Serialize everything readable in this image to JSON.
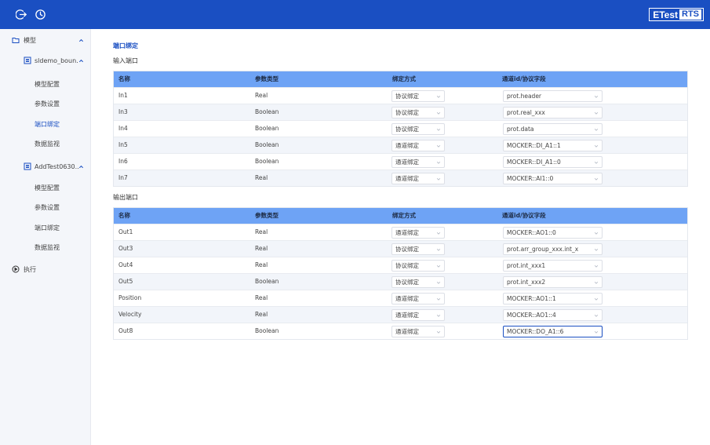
{
  "header": {
    "logo_text": "ETest",
    "logo_badge": "RTS",
    "icons": [
      "logout-icon",
      "history-clock-icon"
    ]
  },
  "sidebar": {
    "root": {
      "label": "模型",
      "icon": "folder-icon",
      "expanded": true
    },
    "models": [
      {
        "label": "sldemo_boun...",
        "icon": "model-icon",
        "expanded": true,
        "items": [
          {
            "label": "模型配置",
            "active": false
          },
          {
            "label": "参数设置",
            "active": false
          },
          {
            "label": "端口绑定",
            "active": true
          },
          {
            "label": "数据监视",
            "active": false
          }
        ]
      },
      {
        "label": "AddTest0630...",
        "icon": "model-icon",
        "expanded": true,
        "items": [
          {
            "label": "模型配置",
            "active": false
          },
          {
            "label": "参数设置",
            "active": false
          },
          {
            "label": "端口绑定",
            "active": false
          },
          {
            "label": "数据监视",
            "active": false
          }
        ]
      }
    ],
    "execute": {
      "label": "执行",
      "icon": "play-circle-icon"
    }
  },
  "main": {
    "title": "端口绑定",
    "columns": [
      "名称",
      "参数类型",
      "绑定方式",
      "通道id/协议字段"
    ],
    "input_section": {
      "title": "输入端口",
      "rows": [
        {
          "name": "In1",
          "type": "Real",
          "bind": "协议绑定",
          "channel": "prot.header"
        },
        {
          "name": "In3",
          "type": "Boolean",
          "bind": "协议绑定",
          "channel": "prot.real_xxx"
        },
        {
          "name": "In4",
          "type": "Boolean",
          "bind": "协议绑定",
          "channel": "prot.data"
        },
        {
          "name": "In5",
          "type": "Boolean",
          "bind": "通道绑定",
          "channel": "MOCKER::DI_A1::1"
        },
        {
          "name": "In6",
          "type": "Boolean",
          "bind": "通道绑定",
          "channel": "MOCKER::DI_A1::0"
        },
        {
          "name": "In7",
          "type": "Real",
          "bind": "通道绑定",
          "channel": "MOCKER::AI1::0"
        }
      ]
    },
    "output_section": {
      "title": "输出端口",
      "rows": [
        {
          "name": "Out1",
          "type": "Real",
          "bind": "通道绑定",
          "channel": "MOCKER::AO1::0"
        },
        {
          "name": "Out3",
          "type": "Real",
          "bind": "协议绑定",
          "channel": "prot.arr_group_xxx.int_x"
        },
        {
          "name": "Out4",
          "type": "Real",
          "bind": "协议绑定",
          "channel": "prot.int_xxx1"
        },
        {
          "name": "Out5",
          "type": "Boolean",
          "bind": "协议绑定",
          "channel": "prot.int_xxx2"
        },
        {
          "name": "Position",
          "type": "Real",
          "bind": "通道绑定",
          "channel": "MOCKER::AO1::1"
        },
        {
          "name": "Velocity",
          "type": "Real",
          "bind": "通道绑定",
          "channel": "MOCKER::AO1::4"
        },
        {
          "name": "Out8",
          "type": "Boolean",
          "bind": "通道绑定",
          "channel": "MOCKER::DO_A1::6"
        }
      ]
    }
  },
  "colors": {
    "header_bg": "#1a4fc2",
    "table_header_bg": "#6ea3f5",
    "active_text": "#1a4fc2",
    "sidebar_bg": "#f4f6fa"
  }
}
